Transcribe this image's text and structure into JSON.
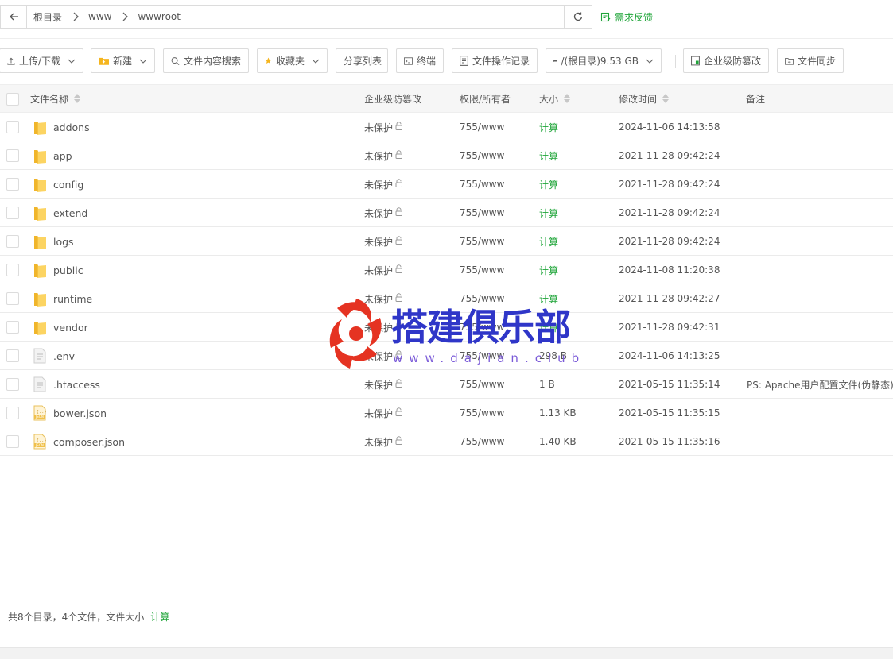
{
  "breadcrumb": [
    "根目录",
    "www",
    "wwwroot"
  ],
  "feedback_label": "需求反馈",
  "toolbar": {
    "upload": "上传/下载",
    "new": "新建",
    "search": "文件内容搜索",
    "favorites": "收藏夹",
    "share": "分享列表",
    "terminal": "终端",
    "oplog": "文件操作记录",
    "disk": "/(根目录)9.53 GB",
    "tamper": "企业级防篡改",
    "sync": "文件同步"
  },
  "columns": {
    "name": "文件名称",
    "tamper": "企业级防篡改",
    "perm": "权限/所有者",
    "size": "大小",
    "mtime": "修改时间",
    "note": "备注"
  },
  "files": [
    {
      "name": "addons",
      "type": "folder",
      "protect": "未保护",
      "perm": "755/www",
      "size": "计算",
      "mtime": "2024-11-06 14:13:58",
      "note": ""
    },
    {
      "name": "app",
      "type": "folder",
      "protect": "未保护",
      "perm": "755/www",
      "size": "计算",
      "mtime": "2021-11-28 09:42:24",
      "note": ""
    },
    {
      "name": "config",
      "type": "folder",
      "protect": "未保护",
      "perm": "755/www",
      "size": "计算",
      "mtime": "2021-11-28 09:42:24",
      "note": ""
    },
    {
      "name": "extend",
      "type": "folder",
      "protect": "未保护",
      "perm": "755/www",
      "size": "计算",
      "mtime": "2021-11-28 09:42:24",
      "note": ""
    },
    {
      "name": "logs",
      "type": "folder",
      "protect": "未保护",
      "perm": "755/www",
      "size": "计算",
      "mtime": "2021-11-28 09:42:24",
      "note": ""
    },
    {
      "name": "public",
      "type": "folder",
      "protect": "未保护",
      "perm": "755/www",
      "size": "计算",
      "mtime": "2024-11-08 11:20:38",
      "note": ""
    },
    {
      "name": "runtime",
      "type": "folder",
      "protect": "未保护",
      "perm": "755/www",
      "size": "计算",
      "mtime": "2021-11-28 09:42:27",
      "note": ""
    },
    {
      "name": "vendor",
      "type": "folder",
      "protect": "未保护",
      "perm": "755/www",
      "size": "计算",
      "mtime": "2021-11-28 09:42:31",
      "note": ""
    },
    {
      "name": ".env",
      "type": "file",
      "protect": "未保护",
      "perm": "755/www",
      "size": "298 B",
      "mtime": "2024-11-06 14:13:25",
      "note": ""
    },
    {
      "name": ".htaccess",
      "type": "file",
      "protect": "未保护",
      "perm": "755/www",
      "size": "1 B",
      "mtime": "2021-05-15 11:35:14",
      "note": "PS: Apache用户配置文件(伪静态)"
    },
    {
      "name": "bower.json",
      "type": "json",
      "protect": "未保护",
      "perm": "755/www",
      "size": "1.13 KB",
      "mtime": "2021-05-15 11:35:15",
      "note": ""
    },
    {
      "name": "composer.json",
      "type": "json",
      "protect": "未保护",
      "perm": "755/www",
      "size": "1.40 KB",
      "mtime": "2021-05-15 11:35:16",
      "note": ""
    }
  ],
  "footer": {
    "summary": "共8个目录，4个文件，文件大小",
    "calc": "计算"
  },
  "watermark": {
    "text": "搭建俱乐部",
    "url": "www.dajian.club"
  }
}
